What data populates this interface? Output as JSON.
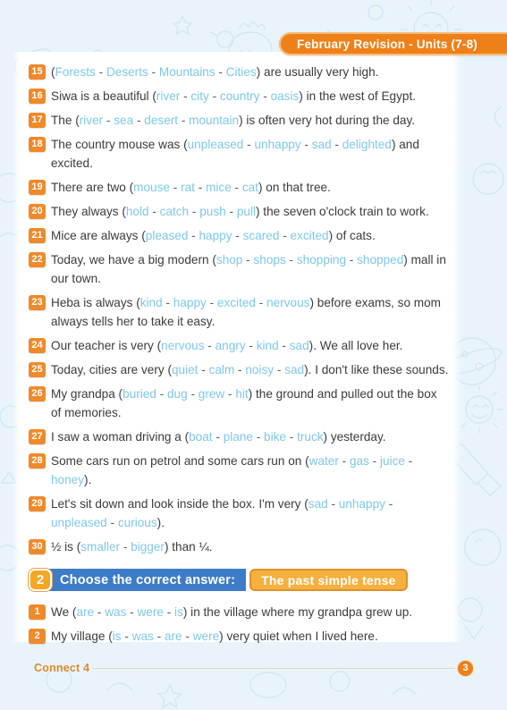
{
  "header": {
    "title": "February Revision - Units (7-8)"
  },
  "questions": [
    {
      "num": "15",
      "parts": [
        {
          "t": "paren",
          "v": "("
        },
        {
          "t": "opt",
          "v": "Forests"
        },
        {
          "t": "sep",
          "v": " - "
        },
        {
          "t": "opt",
          "v": "Deserts"
        },
        {
          "t": "sep",
          "v": " - "
        },
        {
          "t": "opt",
          "v": "Mountains"
        },
        {
          "t": "sep",
          "v": " - "
        },
        {
          "t": "opt",
          "v": "Cities"
        },
        {
          "t": "paren",
          "v": ") are usually very high."
        }
      ]
    },
    {
      "num": "16",
      "parts": [
        {
          "t": "paren",
          "v": "Siwa is a beautiful ("
        },
        {
          "t": "opt",
          "v": "river"
        },
        {
          "t": "sep",
          "v": " - "
        },
        {
          "t": "opt",
          "v": "city"
        },
        {
          "t": "sep",
          "v": " - "
        },
        {
          "t": "opt",
          "v": "country"
        },
        {
          "t": "sep",
          "v": " - "
        },
        {
          "t": "opt",
          "v": "oasis"
        },
        {
          "t": "paren",
          "v": ") in the west of Egypt."
        }
      ]
    },
    {
      "num": "17",
      "parts": [
        {
          "t": "paren",
          "v": "The ("
        },
        {
          "t": "opt",
          "v": "river"
        },
        {
          "t": "sep",
          "v": " - "
        },
        {
          "t": "opt",
          "v": "sea"
        },
        {
          "t": "sep",
          "v": " - "
        },
        {
          "t": "opt",
          "v": "desert"
        },
        {
          "t": "sep",
          "v": " - "
        },
        {
          "t": "opt",
          "v": "mountain"
        },
        {
          "t": "paren",
          "v": ") is often very hot during the day."
        }
      ]
    },
    {
      "num": "18",
      "parts": [
        {
          "t": "paren",
          "v": "The country mouse was ("
        },
        {
          "t": "opt",
          "v": "unpleased"
        },
        {
          "t": "sep",
          "v": " - "
        },
        {
          "t": "opt",
          "v": "unhappy"
        },
        {
          "t": "sep",
          "v": " - "
        },
        {
          "t": "opt",
          "v": "sad"
        },
        {
          "t": "sep",
          "v": " - "
        },
        {
          "t": "opt",
          "v": "delighted"
        },
        {
          "t": "paren",
          "v": ") and excited."
        }
      ]
    },
    {
      "num": "19",
      "parts": [
        {
          "t": "paren",
          "v": "There are two ("
        },
        {
          "t": "opt",
          "v": "mouse"
        },
        {
          "t": "sep",
          "v": " - "
        },
        {
          "t": "opt",
          "v": "rat"
        },
        {
          "t": "sep",
          "v": " - "
        },
        {
          "t": "opt",
          "v": "mice"
        },
        {
          "t": "sep",
          "v": " - "
        },
        {
          "t": "opt",
          "v": "cat"
        },
        {
          "t": "paren",
          "v": ") on that tree."
        }
      ]
    },
    {
      "num": "20",
      "parts": [
        {
          "t": "paren",
          "v": "They always ("
        },
        {
          "t": "opt",
          "v": "hold"
        },
        {
          "t": "sep",
          "v": " - "
        },
        {
          "t": "opt",
          "v": "catch"
        },
        {
          "t": "sep",
          "v": " - "
        },
        {
          "t": "opt",
          "v": "push"
        },
        {
          "t": "sep",
          "v": " - "
        },
        {
          "t": "opt",
          "v": "pull"
        },
        {
          "t": "paren",
          "v": ") the seven o'clock train to work."
        }
      ]
    },
    {
      "num": "21",
      "parts": [
        {
          "t": "paren",
          "v": "Mice are always ("
        },
        {
          "t": "opt",
          "v": "pleased"
        },
        {
          "t": "sep",
          "v": " - "
        },
        {
          "t": "opt",
          "v": "happy"
        },
        {
          "t": "sep",
          "v": " - "
        },
        {
          "t": "opt",
          "v": "scared"
        },
        {
          "t": "sep",
          "v": " - "
        },
        {
          "t": "opt",
          "v": "excited"
        },
        {
          "t": "paren",
          "v": ") of cats."
        }
      ]
    },
    {
      "num": "22",
      "parts": [
        {
          "t": "paren",
          "v": "Today, we have a big modern ("
        },
        {
          "t": "opt",
          "v": "shop"
        },
        {
          "t": "sep",
          "v": " - "
        },
        {
          "t": "opt",
          "v": "shops"
        },
        {
          "t": "sep",
          "v": " - "
        },
        {
          "t": "opt",
          "v": "shopping"
        },
        {
          "t": "sep",
          "v": " - "
        },
        {
          "t": "opt",
          "v": "shopped"
        },
        {
          "t": "paren",
          "v": ") mall in our town."
        }
      ]
    },
    {
      "num": "23",
      "parts": [
        {
          "t": "paren",
          "v": "Heba is always ("
        },
        {
          "t": "opt",
          "v": "kind"
        },
        {
          "t": "sep",
          "v": " - "
        },
        {
          "t": "opt",
          "v": "happy"
        },
        {
          "t": "sep",
          "v": " - "
        },
        {
          "t": "opt",
          "v": "excited"
        },
        {
          "t": "sep",
          "v": " - "
        },
        {
          "t": "opt",
          "v": "nervous"
        },
        {
          "t": "paren",
          "v": ") before exams, so mom always tells her to take it easy."
        }
      ]
    },
    {
      "num": "24",
      "parts": [
        {
          "t": "paren",
          "v": "Our teacher is very ("
        },
        {
          "t": "opt",
          "v": "nervous"
        },
        {
          "t": "sep",
          "v": " - "
        },
        {
          "t": "opt",
          "v": "angry"
        },
        {
          "t": "sep",
          "v": " - "
        },
        {
          "t": "opt",
          "v": "kind"
        },
        {
          "t": "sep",
          "v": " - "
        },
        {
          "t": "opt",
          "v": "sad"
        },
        {
          "t": "paren",
          "v": "). We all love her."
        }
      ]
    },
    {
      "num": "25",
      "parts": [
        {
          "t": "paren",
          "v": "Today, cities are very ("
        },
        {
          "t": "opt",
          "v": "quiet"
        },
        {
          "t": "sep",
          "v": " - "
        },
        {
          "t": "opt",
          "v": "calm"
        },
        {
          "t": "sep",
          "v": " - "
        },
        {
          "t": "opt",
          "v": "noisy"
        },
        {
          "t": "sep",
          "v": " - "
        },
        {
          "t": "opt",
          "v": "sad"
        },
        {
          "t": "paren",
          "v": "). I don't like these sounds."
        }
      ]
    },
    {
      "num": "26",
      "parts": [
        {
          "t": "paren",
          "v": "My grandpa ("
        },
        {
          "t": "opt",
          "v": "buried"
        },
        {
          "t": "sep",
          "v": " - "
        },
        {
          "t": "opt",
          "v": "dug"
        },
        {
          "t": "sep",
          "v": " - "
        },
        {
          "t": "opt",
          "v": "grew"
        },
        {
          "t": "sep",
          "v": " - "
        },
        {
          "t": "opt",
          "v": "hit"
        },
        {
          "t": "paren",
          "v": ") the ground and pulled out the box of memories."
        }
      ]
    },
    {
      "num": "27",
      "parts": [
        {
          "t": "paren",
          "v": "I saw a woman driving a ("
        },
        {
          "t": "opt",
          "v": "boat"
        },
        {
          "t": "sep",
          "v": " - "
        },
        {
          "t": "opt",
          "v": "plane"
        },
        {
          "t": "sep",
          "v": " - "
        },
        {
          "t": "opt",
          "v": "bike"
        },
        {
          "t": "sep",
          "v": " - "
        },
        {
          "t": "opt",
          "v": "truck"
        },
        {
          "t": "paren",
          "v": ") yesterday."
        }
      ]
    },
    {
      "num": "28",
      "parts": [
        {
          "t": "paren",
          "v": "Some cars run on petrol and some cars run on ("
        },
        {
          "t": "opt",
          "v": "water"
        },
        {
          "t": "sep",
          "v": " - "
        },
        {
          "t": "opt",
          "v": "gas"
        },
        {
          "t": "sep",
          "v": " - "
        },
        {
          "t": "opt",
          "v": "juice"
        },
        {
          "t": "sep",
          "v": " - "
        },
        {
          "t": "opt",
          "v": "honey"
        },
        {
          "t": "paren",
          "v": ")."
        }
      ]
    },
    {
      "num": "29",
      "parts": [
        {
          "t": "paren",
          "v": "Let's sit down and look inside the box. I'm very ("
        },
        {
          "t": "opt",
          "v": "sad"
        },
        {
          "t": "sep",
          "v": " - "
        },
        {
          "t": "opt",
          "v": "unhappy"
        },
        {
          "t": "sep",
          "v": " - "
        },
        {
          "t": "opt",
          "v": "unpleased"
        },
        {
          "t": "sep",
          "v": " - "
        },
        {
          "t": "opt",
          "v": "curious"
        },
        {
          "t": "paren",
          "v": ")."
        }
      ]
    },
    {
      "num": "30",
      "parts": [
        {
          "t": "paren",
          "v": "½ is ("
        },
        {
          "t": "opt",
          "v": "smaller"
        },
        {
          "t": "sep",
          "v": " - "
        },
        {
          "t": "opt",
          "v": "bigger"
        },
        {
          "t": "paren",
          "v": ") than ¼."
        }
      ]
    }
  ],
  "section2": {
    "number": "2",
    "instruction": "Choose the correct answer:",
    "tag": "The past simple tense",
    "questions": [
      {
        "num": "1",
        "parts": [
          {
            "t": "paren",
            "v": "We ("
          },
          {
            "t": "opt",
            "v": "are"
          },
          {
            "t": "sep",
            "v": " - "
          },
          {
            "t": "opt",
            "v": "was"
          },
          {
            "t": "sep",
            "v": " - "
          },
          {
            "t": "opt",
            "v": "were"
          },
          {
            "t": "sep",
            "v": " - "
          },
          {
            "t": "opt",
            "v": "is"
          },
          {
            "t": "paren",
            "v": ") in the village where my grandpa grew up."
          }
        ]
      },
      {
        "num": "2",
        "parts": [
          {
            "t": "paren",
            "v": "My village ("
          },
          {
            "t": "opt",
            "v": "is"
          },
          {
            "t": "sep",
            "v": " - "
          },
          {
            "t": "opt",
            "v": "was"
          },
          {
            "t": "sep",
            "v": " - "
          },
          {
            "t": "opt",
            "v": "are"
          },
          {
            "t": "sep",
            "v": " - "
          },
          {
            "t": "opt",
            "v": "were"
          },
          {
            "t": "paren",
            "v": ") very quiet when I lived here."
          }
        ]
      }
    ]
  },
  "footer": {
    "label": "Connect 4",
    "page": "3"
  },
  "colors": {
    "accent_orange": "#ee8019",
    "badge_orange": "#ef8a2a",
    "banner_blue": "#3d7cc9",
    "tag_orange": "#f5b03e",
    "option_blue": "#7ec8e8",
    "page_bg": "#e9f4fa",
    "text": "#3b3b3b"
  }
}
